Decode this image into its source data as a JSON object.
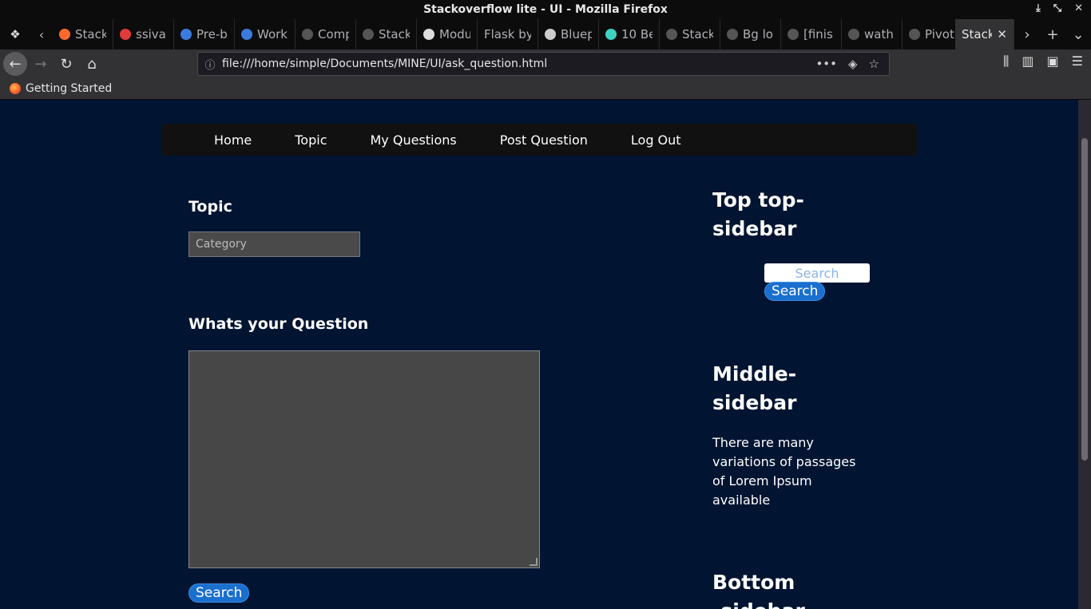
{
  "window": {
    "title": "Stackoverflow lite - UI - Mozilla Firefox"
  },
  "tabs": [
    {
      "label": "Stack",
      "color": "#ff6a2c"
    },
    {
      "label": "ssiva",
      "color": "#e03b3b"
    },
    {
      "label": "Pre-b",
      "color": "#3b7be0"
    },
    {
      "label": "Work",
      "color": "#3b7be0"
    },
    {
      "label": "Comp",
      "color": "#555555"
    },
    {
      "label": "Stack",
      "color": "#555555"
    },
    {
      "label": "Modu",
      "color": "#dddddd"
    },
    {
      "label": "Flask by",
      "color": ""
    },
    {
      "label": "Bluep",
      "color": "#cccccc"
    },
    {
      "label": "10 Be",
      "color": "#3fd2c0"
    },
    {
      "label": "Stack",
      "color": "#555555"
    },
    {
      "label": "Bg lo",
      "color": "#555555"
    },
    {
      "label": "[finis",
      "color": "#555555"
    },
    {
      "label": "wath",
      "color": "#555555"
    },
    {
      "label": "Pivot",
      "color": "#555555"
    }
  ],
  "active_tab": {
    "label": "Stack",
    "close": "✕"
  },
  "address": {
    "url": "file:///home/simple/Documents/MINE/UI/ask_question.html"
  },
  "bookmarks": [
    {
      "label": "Getting Started"
    }
  ],
  "site": {
    "menu": [
      "Home",
      "Topic",
      "My Questions",
      "Post Question",
      "Log Out"
    ],
    "topic_heading": "Topic",
    "category_placeholder": "Category",
    "question_heading": "Whats your Question",
    "submit_label": "Search",
    "sidebar": {
      "top_heading_1": "Top top-",
      "top_heading_2": "sidebar",
      "search_placeholder": "Search",
      "search_button": "Search",
      "middle_heading_1": "Middle-",
      "middle_heading_2": "sidebar",
      "middle_text": "There are many variations of passages of Lorem Ipsum available",
      "bottom_heading_1": "Bottom",
      "bottom_heading_2": "-sidebar"
    }
  }
}
